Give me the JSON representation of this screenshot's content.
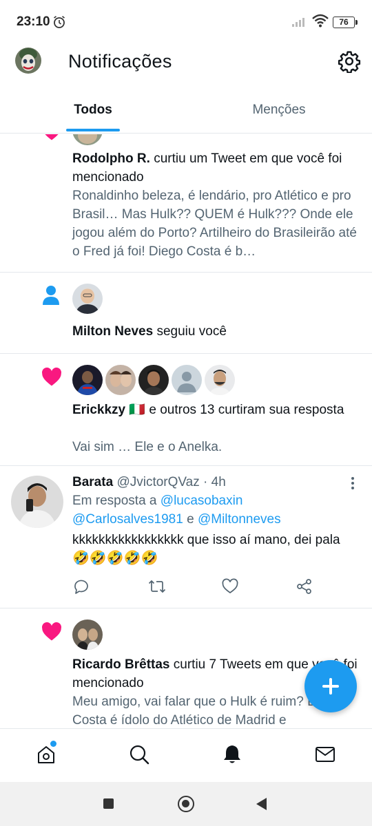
{
  "status_bar": {
    "time": "23:10",
    "battery": "76"
  },
  "header": {
    "title": "Notificações"
  },
  "tabs": [
    {
      "label": "Todos",
      "active": true
    },
    {
      "label": "Menções",
      "active": false
    }
  ],
  "notifications": {
    "n1": {
      "user": "Rodolpho R.",
      "action": " curtiu um Tweet em que você foi mencionado",
      "preview": "Ronaldinho beleza, é lendário, pro Atlético e pro Brasil… Mas Hulk?? QUEM é Hulk??? Onde ele jogou além do Porto? Artilheiro do Brasileirão até o Fred já foi! Diego Costa é b…"
    },
    "n2": {
      "user": "Milton Neves",
      "action": " seguiu você"
    },
    "n3": {
      "user": "Erickkzy",
      "flag": "🇮🇹",
      "action": " e outros 13 curtiram sua resposta",
      "preview": "Vai sim … Ele e o Anelka."
    },
    "tweet": {
      "name": "Barata",
      "handle": "@JvictorQVaz",
      "dot": " · ",
      "time": "4h",
      "reply_prefix": "Em resposta a ",
      "mention1": "@lucasobaxin",
      "mention2": "@Carlosalves1981",
      "and_word": " e ",
      "mention3": "@Miltonneves",
      "body": "kkkkkkkkkkkkkkkkk que isso aí mano, dei pala",
      "emojis": "🤣🤣🤣🤣🤣"
    },
    "n5": {
      "user": "Ricardo Brêttas",
      "action": " curtiu 7 Tweets em que você foi mencionado",
      "preview": "Meu amigo, vai falar que o Hulk é ruim? Diego Costa é ídolo do Atlético de Madrid e"
    }
  },
  "colors": {
    "accent": "#1d9bf0",
    "like": "#f91880",
    "muted": "#536471",
    "text": "#0f1419"
  },
  "icons": {
    "header": "gear-icon",
    "follow": "person-icon",
    "like": "heart-icon",
    "tweet_actions": [
      "reply-icon",
      "retweet-icon",
      "like-icon",
      "share-icon"
    ],
    "bottom_nav": [
      "home-icon",
      "search-icon",
      "bell-icon",
      "mail-icon"
    ],
    "fab": "plus-icon"
  }
}
